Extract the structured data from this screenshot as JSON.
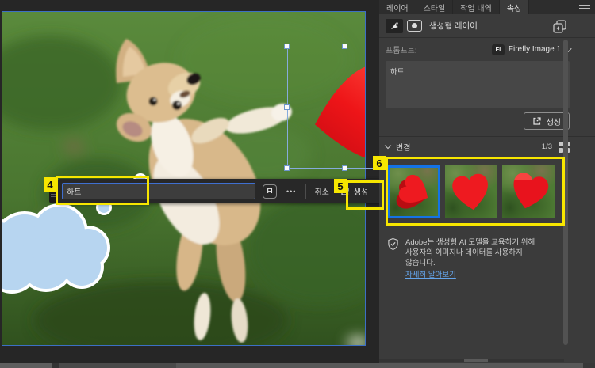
{
  "colors": {
    "accent_blue": "#1473e6",
    "annotation_yellow": "#f7e600",
    "link_blue": "#64a4ea",
    "heart_red": "#e8131d",
    "selection_blue": "#86abdc"
  },
  "panel_tabs": {
    "layers": "레이어",
    "styles": "스타일",
    "history": "작업 내역",
    "properties": "속성"
  },
  "properties_panel": {
    "layer_title": "생성형 레이어",
    "prompt_label": "프롬프트:",
    "model_badge": "Fl",
    "model_name": "Firefly Image 1",
    "prompt_value": "하트",
    "generate_label": "생성",
    "variations_label": "변경",
    "variations_counter": "1/3",
    "disclaimer_line1": "Adobe는 생성형 AI 모델을 교육하기 위해",
    "disclaimer_line2": "사용자의 이미지나 데이터를 사용하지",
    "disclaimer_line3": "않습니다.",
    "learn_more_link": "자세히 알아보기"
  },
  "canvas_taskbar": {
    "prompt_value": "하트",
    "model_badge": "Fl",
    "more_label": "•••",
    "cancel_label": "취소",
    "generate_label": "생성"
  },
  "variations": {
    "count": 3,
    "selected_index": 0
  },
  "annotations": {
    "step4": "4",
    "step5": "5",
    "step6": "6"
  }
}
